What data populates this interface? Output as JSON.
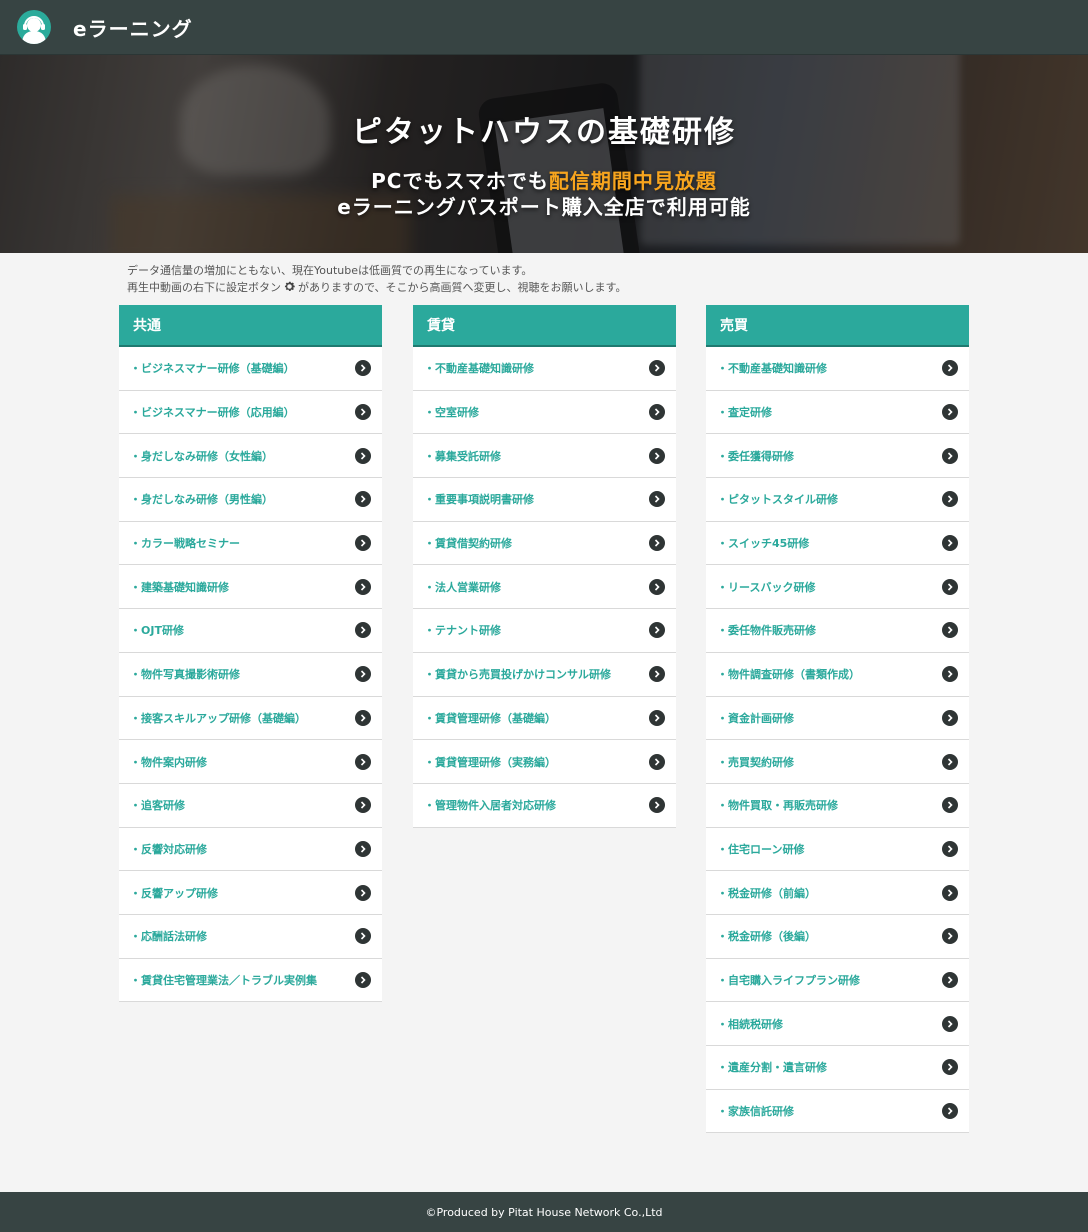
{
  "header": {
    "app_title": "eラーニング"
  },
  "hero": {
    "title": "ピタットハウスの基礎研修",
    "line1_prefix": "PCでもスマホでも",
    "line1_highlight": "配信期間中見放題",
    "line2": "eラーニングパスポート購入全店で利用可能",
    "highlight_color": "#f8a51e"
  },
  "notice": {
    "line1": "データ通信量の増加にともない、現在Youtubeは低画質での再生になっています。",
    "line2_before": "再生中動画の右下に設定ボタン",
    "line2_after": "がありますので、そこから高画質へ変更し、視聴をお願いします。"
  },
  "columns": [
    {
      "title": "共通",
      "items": [
        "・ビジネスマナー研修（基礎編）",
        "・ビジネスマナー研修（応用編）",
        "・身だしなみ研修（女性編）",
        "・身だしなみ研修（男性編）",
        "・カラー戦略セミナー",
        "・建築基礎知識研修",
        "・OJT研修",
        "・物件写真撮影術研修",
        "・接客スキルアップ研修（基礎編）",
        "・物件案内研修",
        "・追客研修",
        "・反響対応研修",
        "・反響アップ研修",
        "・応酬話法研修",
        "・賃貸住宅管理業法／トラブル実例集"
      ]
    },
    {
      "title": "賃貸",
      "items": [
        "・不動産基礎知識研修",
        "・空室研修",
        "・募集受託研修",
        "・重要事項説明書研修",
        "・賃貸借契約研修",
        "・法人営業研修",
        "・テナント研修",
        "・賃貸から売買投げかけコンサル研修",
        "・賃貸管理研修（基礎編）",
        "・賃貸管理研修（実務編）",
        "・管理物件入居者対応研修"
      ]
    },
    {
      "title": "売買",
      "items": [
        "・不動産基礎知識研修",
        "・査定研修",
        "・委任獲得研修",
        "・ピタットスタイル研修",
        "・スイッチ45研修",
        "・リースバック研修",
        "・委任物件販売研修",
        "・物件調査研修（書類作成）",
        "・資金計画研修",
        "・売買契約研修",
        "・物件買取・再販売研修",
        "・住宅ローン研修",
        "・税金研修（前編）",
        "・税金研修（後編）",
        "・自宅購入ライフプラン研修",
        "・相続税研修",
        "・遺産分割・遺言研修",
        "・家族信託研修"
      ]
    }
  ],
  "footer": {
    "text": "©Produced by Pitat House Network Co.,Ltd"
  },
  "colors": {
    "header_bg": "#374443",
    "accent": "#2ba99c",
    "arrow_bg": "#2f3535"
  },
  "icons": {
    "logo": "headset-user-icon",
    "item_arrow": "chevron-right-circle-icon",
    "settings": "gear-icon"
  }
}
